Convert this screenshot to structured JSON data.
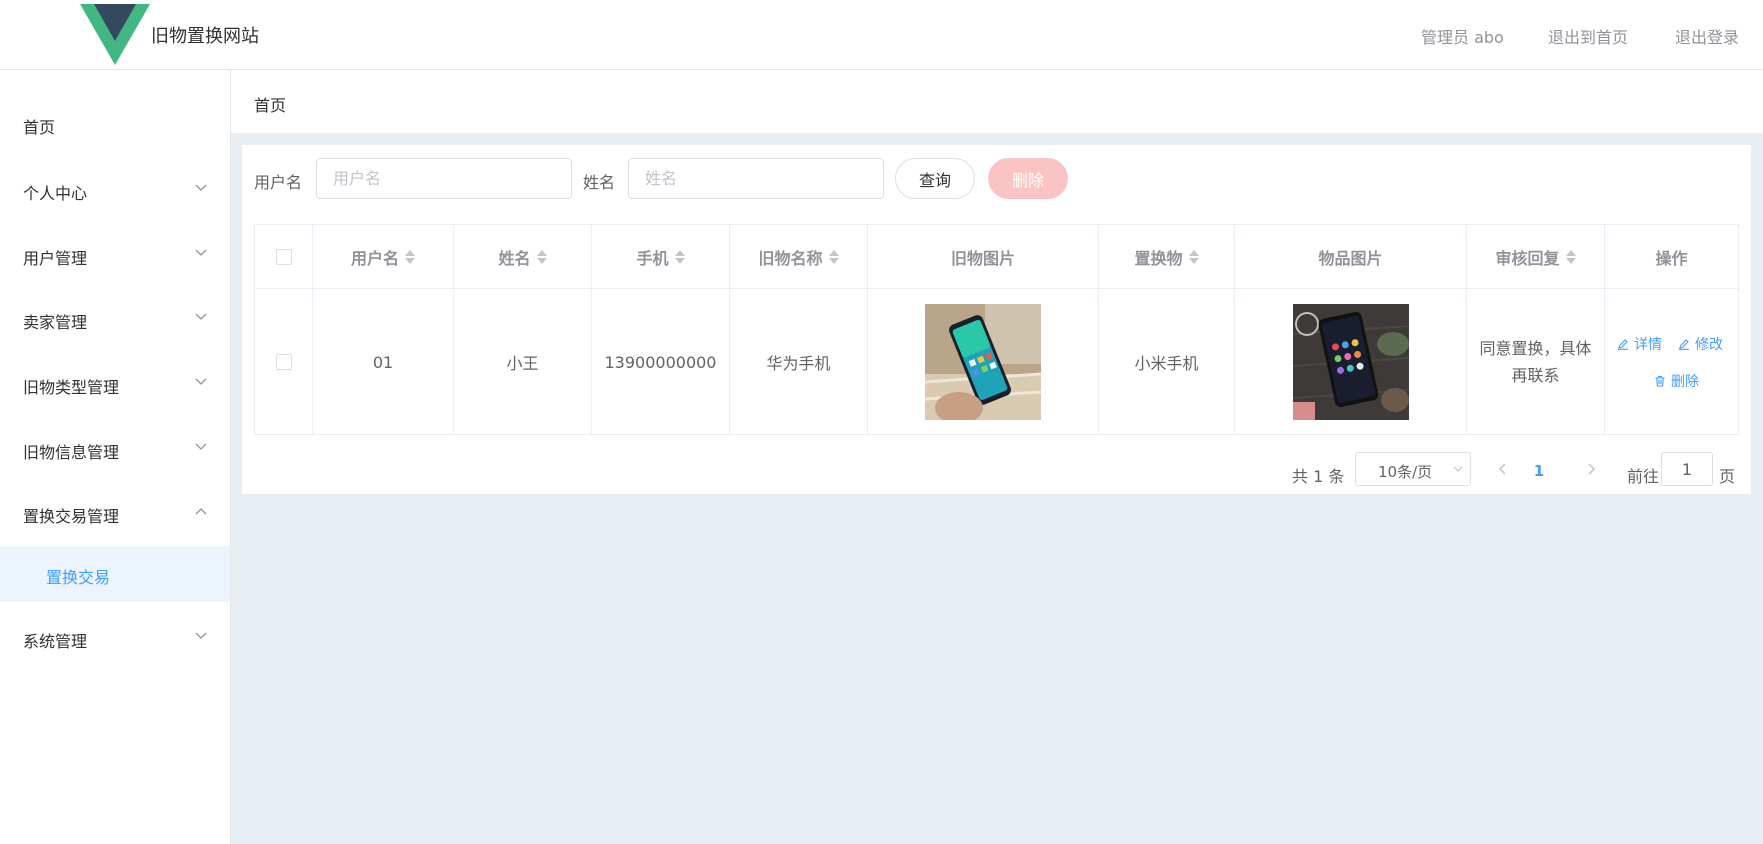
{
  "header": {
    "site_title": "旧物置换网站",
    "user_label": "管理员 abo",
    "back_home": "退出到首页",
    "logout": "退出登录",
    "logo_colors": {
      "outer": "#41b883",
      "inner": "#35495e"
    }
  },
  "sidebar": {
    "items": [
      {
        "label": "首页",
        "icon": "none"
      },
      {
        "label": "个人中心",
        "icon": "chevron-down-icon"
      },
      {
        "label": "用户管理",
        "icon": "chevron-down-icon"
      },
      {
        "label": "卖家管理",
        "icon": "chevron-down-icon"
      },
      {
        "label": "旧物类型管理",
        "icon": "chevron-down-icon"
      },
      {
        "label": "旧物信息管理",
        "icon": "chevron-down-icon"
      },
      {
        "label": "置换交易管理",
        "icon": "chevron-up-icon"
      },
      {
        "label": "系统管理",
        "icon": "chevron-down-icon"
      }
    ],
    "active_submenu": "置换交易",
    "active_color": "#409eff"
  },
  "breadcrumb": "首页",
  "search": {
    "username_label": "用户名",
    "username_placeholder": "用户名",
    "name_label": "姓名",
    "name_placeholder": "姓名",
    "query_button": "查询",
    "delete_button": "删除"
  },
  "table": {
    "headers": [
      "用户名",
      "姓名",
      "手机",
      "旧物名称",
      "旧物图片",
      "置换物",
      "物品图片",
      "审核回复",
      "操作"
    ],
    "rows": [
      {
        "username": "01",
        "name": "小王",
        "phone": "13900000000",
        "item_name": "华为手机",
        "exchange_item": "小米手机",
        "reply": "同意置换，具体再联系",
        "actions": {
          "detail": "详情",
          "edit": "修改",
          "delete": "删除"
        }
      }
    ]
  },
  "pagination": {
    "total": "共 1 条",
    "page_size": "10条/页",
    "current_page": "1",
    "goto_label": "前往",
    "goto_value": "1",
    "page_suffix": "页"
  }
}
